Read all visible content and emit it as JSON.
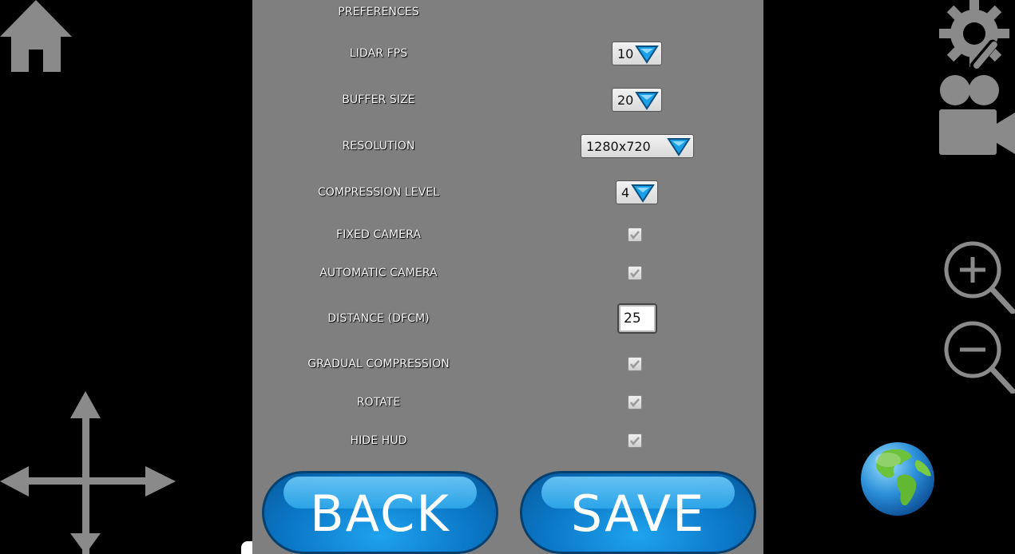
{
  "panel": {
    "title": "PREFERENCES",
    "rows": [
      {
        "label": "LIDAR FPS",
        "control": "dropdown",
        "value": "10"
      },
      {
        "label": "BUFFER SIZE",
        "control": "dropdown",
        "value": "20"
      },
      {
        "label": "RESOLUTION",
        "control": "dropdown",
        "value": "1280x720"
      },
      {
        "label": "COMPRESSION LEVEL",
        "control": "dropdown",
        "value": "4"
      },
      {
        "label": "FIXED CAMERA",
        "control": "checkbox",
        "checked": true
      },
      {
        "label": "AUTOMATIC CAMERA",
        "control": "checkbox",
        "checked": true
      },
      {
        "label": "DISTANCE (DFCM)",
        "control": "text",
        "value": "25"
      },
      {
        "label": "GRADUAL COMPRESSION",
        "control": "checkbox",
        "checked": true
      },
      {
        "label": "ROTATE",
        "control": "checkbox",
        "checked": true
      },
      {
        "label": "HIDE HUD",
        "control": "checkbox",
        "checked": true
      }
    ],
    "back_label": "BACK",
    "save_label": "SAVE"
  },
  "icons": {
    "left": [
      "home-icon",
      "move-arrows-icon"
    ],
    "right": [
      "settings-tools-icon",
      "video-camera-icon",
      "zoom-in-icon",
      "zoom-out-icon",
      "globe-icon"
    ]
  },
  "colors": {
    "panel_bg": "#7f7f7f",
    "button_blue": "#0b78c8",
    "dropdown_arrow": "#1aa0e8",
    "hud_icon": "#8a8a8a"
  }
}
